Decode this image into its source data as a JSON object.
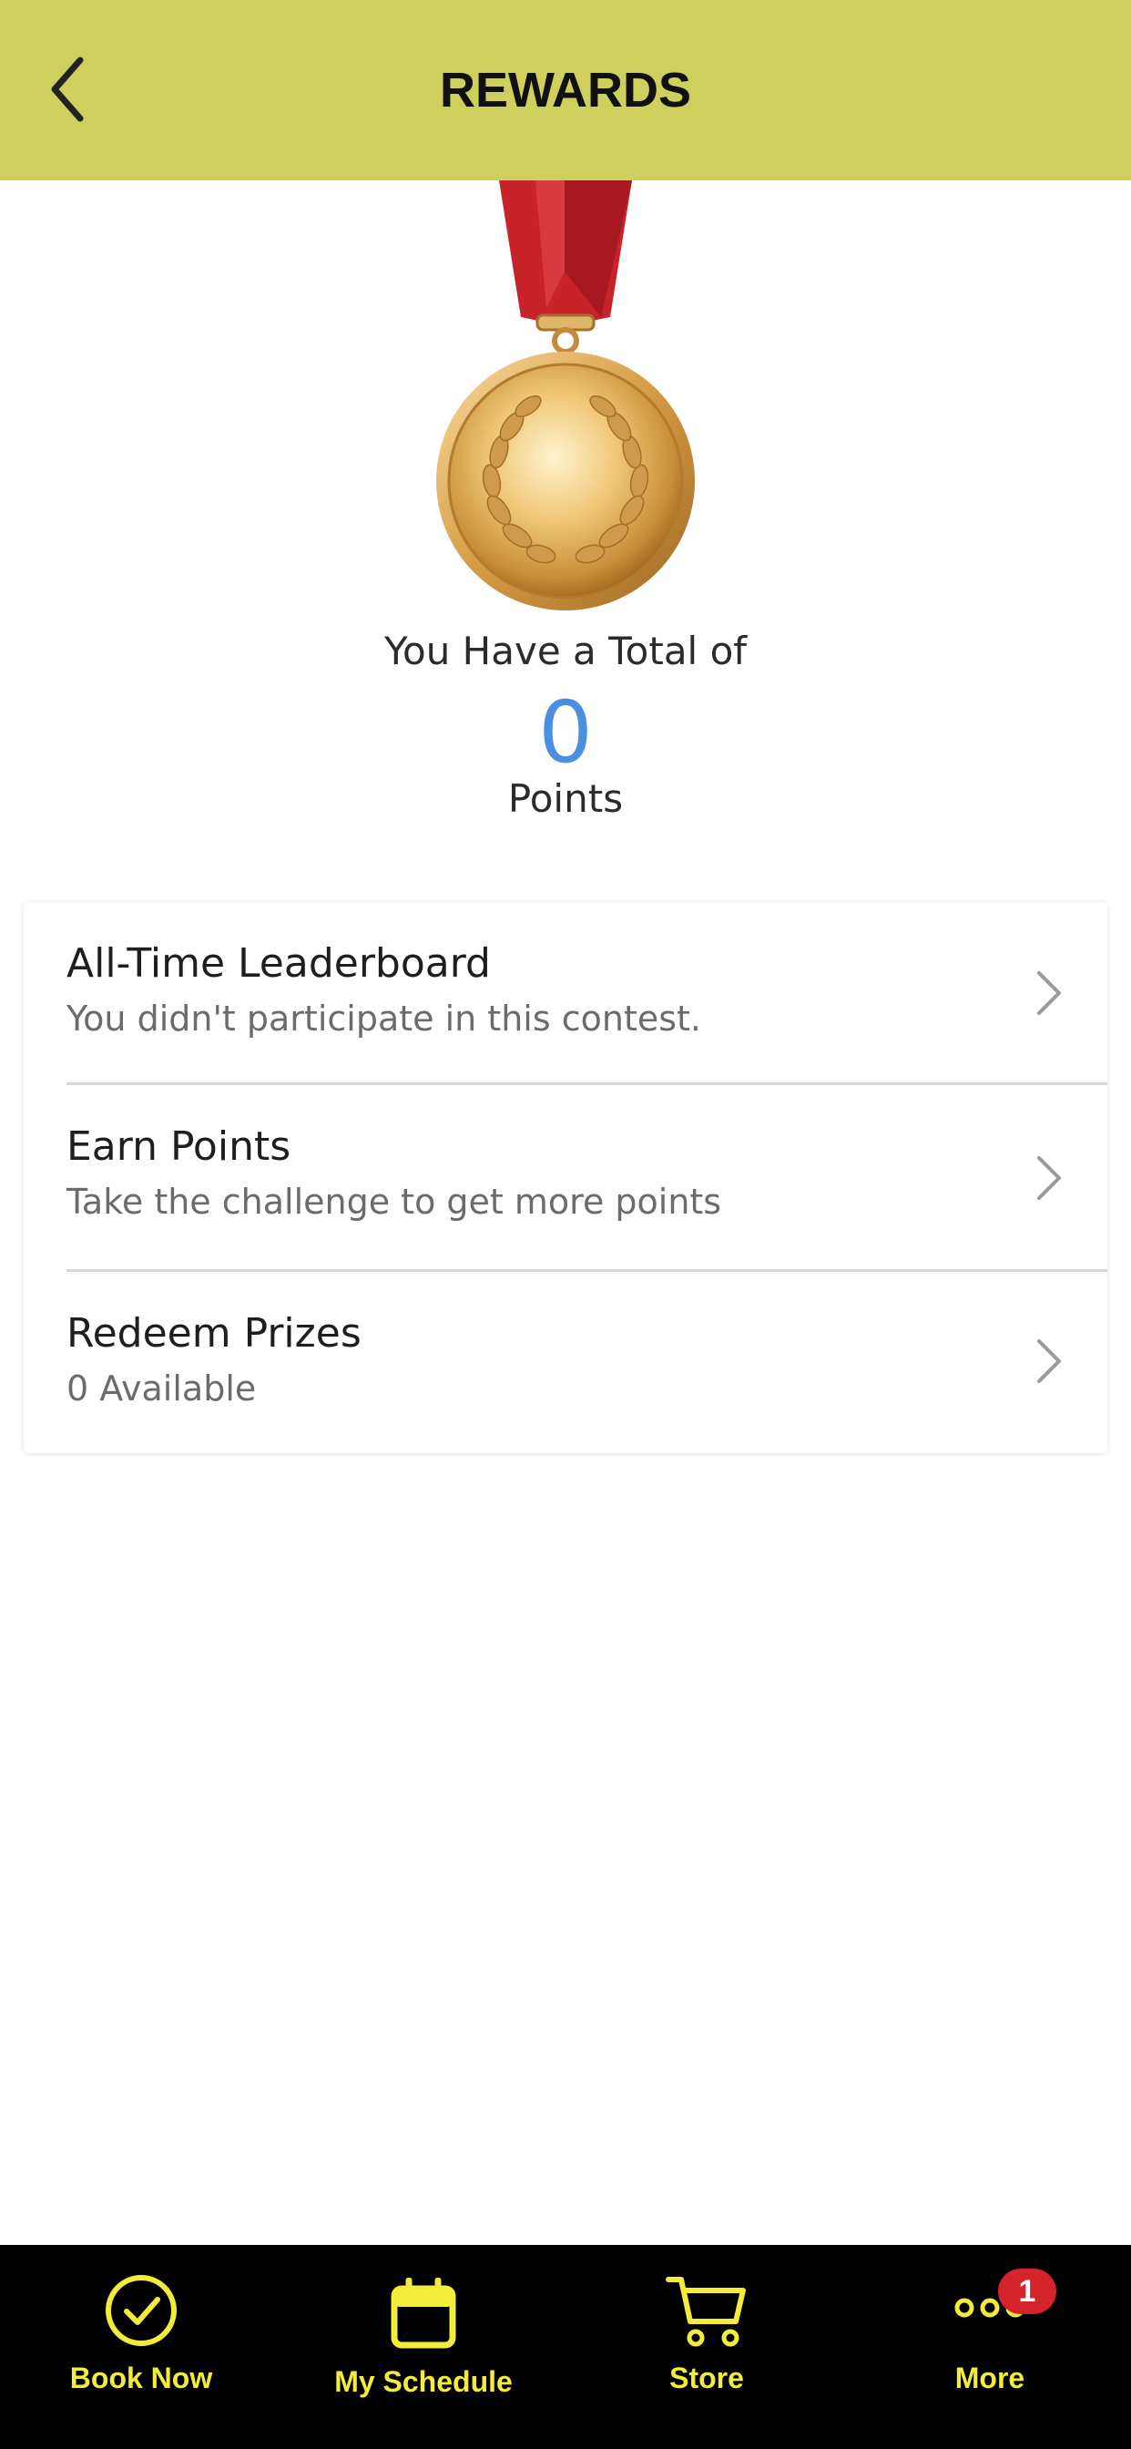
{
  "header": {
    "title": "REWARDS"
  },
  "points": {
    "total_label": "You Have a Total of",
    "value": "0",
    "unit": "Points"
  },
  "menu": [
    {
      "title": "All-Time Leaderboard",
      "subtitle": "You didn't participate in this contest."
    },
    {
      "title": "Earn Points",
      "subtitle": "Take the challenge to get more points"
    },
    {
      "title": "Redeem Prizes",
      "subtitle": "0 Available"
    }
  ],
  "tabbar": {
    "items": [
      {
        "label": "Book Now",
        "icon": "check-circle-icon"
      },
      {
        "label": "My Schedule",
        "icon": "calendar-icon"
      },
      {
        "label": "Store",
        "icon": "cart-icon"
      },
      {
        "label": "More",
        "icon": "more-dots-icon"
      }
    ],
    "more_badge": "1"
  },
  "colors": {
    "header_bg": "#cfcf5e",
    "points_blue": "#4a8fe0",
    "tab_accent": "#f3ec3a",
    "badge_red": "#d4232b"
  }
}
